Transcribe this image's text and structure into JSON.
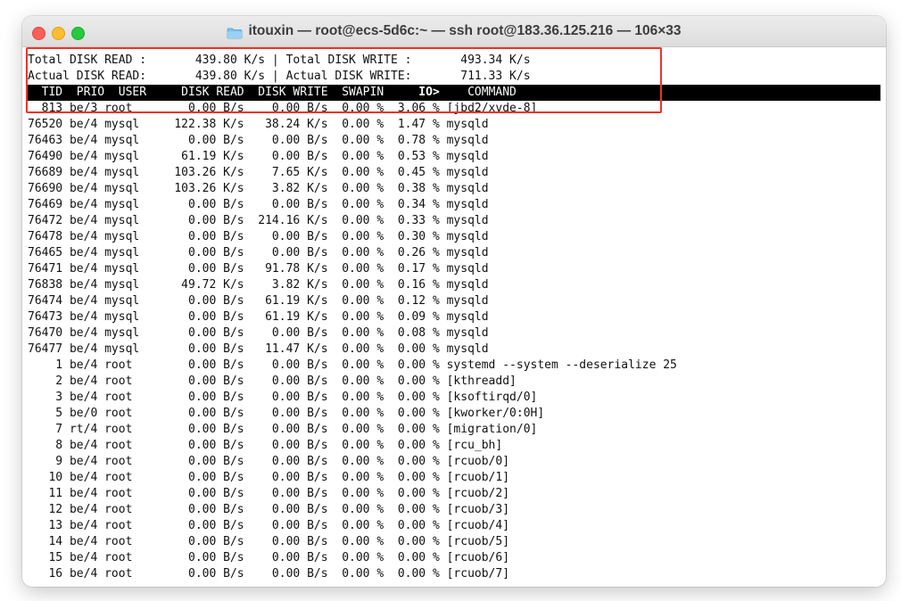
{
  "window": {
    "title": "itouxin — root@ecs-5d6c:~ — ssh root@183.36.125.216 — 106×33",
    "title_icon": "folder-icon",
    "controls": [
      "close",
      "minimize",
      "zoom"
    ]
  },
  "colors": {
    "highlight_box": "#e8362b",
    "header_bg": "#000000",
    "header_fg": "#ffffff",
    "text": "#111111"
  },
  "summary": {
    "total_read": "Total DISK READ :       439.80 K/s | Total DISK WRITE :       493.34 K/s",
    "actual_read": "Actual DISK READ:       439.80 K/s | Actual DISK WRITE:       711.33 K/s"
  },
  "header": {
    "pre": "  TID  PRIO  USER     DISK READ  DISK WRITE  SWAPIN     ",
    "sort_col": "IO>",
    "post": "    COMMAND"
  },
  "rows": [
    {
      "tid": "813",
      "prio": "be/3",
      "user": "root",
      "read": "0.00 B/s",
      "write": "0.00 B/s",
      "swapin": "0.00 %",
      "io": "3.06 %",
      "command": "[jbd2/xvde-8]"
    },
    {
      "tid": "76520",
      "prio": "be/4",
      "user": "mysql",
      "read": "122.38 K/s",
      "write": "38.24 K/s",
      "swapin": "0.00 %",
      "io": "1.47 %",
      "command": "mysqld"
    },
    {
      "tid": "76463",
      "prio": "be/4",
      "user": "mysql",
      "read": "0.00 B/s",
      "write": "0.00 B/s",
      "swapin": "0.00 %",
      "io": "0.78 %",
      "command": "mysqld"
    },
    {
      "tid": "76490",
      "prio": "be/4",
      "user": "mysql",
      "read": "61.19 K/s",
      "write": "0.00 B/s",
      "swapin": "0.00 %",
      "io": "0.53 %",
      "command": "mysqld"
    },
    {
      "tid": "76689",
      "prio": "be/4",
      "user": "mysql",
      "read": "103.26 K/s",
      "write": "7.65 K/s",
      "swapin": "0.00 %",
      "io": "0.45 %",
      "command": "mysqld"
    },
    {
      "tid": "76690",
      "prio": "be/4",
      "user": "mysql",
      "read": "103.26 K/s",
      "write": "3.82 K/s",
      "swapin": "0.00 %",
      "io": "0.38 %",
      "command": "mysqld"
    },
    {
      "tid": "76469",
      "prio": "be/4",
      "user": "mysql",
      "read": "0.00 B/s",
      "write": "0.00 B/s",
      "swapin": "0.00 %",
      "io": "0.34 %",
      "command": "mysqld"
    },
    {
      "tid": "76472",
      "prio": "be/4",
      "user": "mysql",
      "read": "0.00 B/s",
      "write": "214.16 K/s",
      "swapin": "0.00 %",
      "io": "0.33 %",
      "command": "mysqld"
    },
    {
      "tid": "76478",
      "prio": "be/4",
      "user": "mysql",
      "read": "0.00 B/s",
      "write": "0.00 B/s",
      "swapin": "0.00 %",
      "io": "0.30 %",
      "command": "mysqld"
    },
    {
      "tid": "76465",
      "prio": "be/4",
      "user": "mysql",
      "read": "0.00 B/s",
      "write": "0.00 B/s",
      "swapin": "0.00 %",
      "io": "0.26 %",
      "command": "mysqld"
    },
    {
      "tid": "76471",
      "prio": "be/4",
      "user": "mysql",
      "read": "0.00 B/s",
      "write": "91.78 K/s",
      "swapin": "0.00 %",
      "io": "0.17 %",
      "command": "mysqld"
    },
    {
      "tid": "76838",
      "prio": "be/4",
      "user": "mysql",
      "read": "49.72 K/s",
      "write": "3.82 K/s",
      "swapin": "0.00 %",
      "io": "0.16 %",
      "command": "mysqld"
    },
    {
      "tid": "76474",
      "prio": "be/4",
      "user": "mysql",
      "read": "0.00 B/s",
      "write": "61.19 K/s",
      "swapin": "0.00 %",
      "io": "0.12 %",
      "command": "mysqld"
    },
    {
      "tid": "76473",
      "prio": "be/4",
      "user": "mysql",
      "read": "0.00 B/s",
      "write": "61.19 K/s",
      "swapin": "0.00 %",
      "io": "0.09 %",
      "command": "mysqld"
    },
    {
      "tid": "76470",
      "prio": "be/4",
      "user": "mysql",
      "read": "0.00 B/s",
      "write": "0.00 B/s",
      "swapin": "0.00 %",
      "io": "0.08 %",
      "command": "mysqld"
    },
    {
      "tid": "76477",
      "prio": "be/4",
      "user": "mysql",
      "read": "0.00 B/s",
      "write": "11.47 K/s",
      "swapin": "0.00 %",
      "io": "0.00 %",
      "command": "mysqld"
    },
    {
      "tid": "1",
      "prio": "be/4",
      "user": "root",
      "read": "0.00 B/s",
      "write": "0.00 B/s",
      "swapin": "0.00 %",
      "io": "0.00 %",
      "command": "systemd --system --deserialize 25"
    },
    {
      "tid": "2",
      "prio": "be/4",
      "user": "root",
      "read": "0.00 B/s",
      "write": "0.00 B/s",
      "swapin": "0.00 %",
      "io": "0.00 %",
      "command": "[kthreadd]"
    },
    {
      "tid": "3",
      "prio": "be/4",
      "user": "root",
      "read": "0.00 B/s",
      "write": "0.00 B/s",
      "swapin": "0.00 %",
      "io": "0.00 %",
      "command": "[ksoftirqd/0]"
    },
    {
      "tid": "5",
      "prio": "be/0",
      "user": "root",
      "read": "0.00 B/s",
      "write": "0.00 B/s",
      "swapin": "0.00 %",
      "io": "0.00 %",
      "command": "[kworker/0:0H]"
    },
    {
      "tid": "7",
      "prio": "rt/4",
      "user": "root",
      "read": "0.00 B/s",
      "write": "0.00 B/s",
      "swapin": "0.00 %",
      "io": "0.00 %",
      "command": "[migration/0]"
    },
    {
      "tid": "8",
      "prio": "be/4",
      "user": "root",
      "read": "0.00 B/s",
      "write": "0.00 B/s",
      "swapin": "0.00 %",
      "io": "0.00 %",
      "command": "[rcu_bh]"
    },
    {
      "tid": "9",
      "prio": "be/4",
      "user": "root",
      "read": "0.00 B/s",
      "write": "0.00 B/s",
      "swapin": "0.00 %",
      "io": "0.00 %",
      "command": "[rcuob/0]"
    },
    {
      "tid": "10",
      "prio": "be/4",
      "user": "root",
      "read": "0.00 B/s",
      "write": "0.00 B/s",
      "swapin": "0.00 %",
      "io": "0.00 %",
      "command": "[rcuob/1]"
    },
    {
      "tid": "11",
      "prio": "be/4",
      "user": "root",
      "read": "0.00 B/s",
      "write": "0.00 B/s",
      "swapin": "0.00 %",
      "io": "0.00 %",
      "command": "[rcuob/2]"
    },
    {
      "tid": "12",
      "prio": "be/4",
      "user": "root",
      "read": "0.00 B/s",
      "write": "0.00 B/s",
      "swapin": "0.00 %",
      "io": "0.00 %",
      "command": "[rcuob/3]"
    },
    {
      "tid": "13",
      "prio": "be/4",
      "user": "root",
      "read": "0.00 B/s",
      "write": "0.00 B/s",
      "swapin": "0.00 %",
      "io": "0.00 %",
      "command": "[rcuob/4]"
    },
    {
      "tid": "14",
      "prio": "be/4",
      "user": "root",
      "read": "0.00 B/s",
      "write": "0.00 B/s",
      "swapin": "0.00 %",
      "io": "0.00 %",
      "command": "[rcuob/5]"
    },
    {
      "tid": "15",
      "prio": "be/4",
      "user": "root",
      "read": "0.00 B/s",
      "write": "0.00 B/s",
      "swapin": "0.00 %",
      "io": "0.00 %",
      "command": "[rcuob/6]"
    },
    {
      "tid": "16",
      "prio": "be/4",
      "user": "root",
      "read": "0.00 B/s",
      "write": "0.00 B/s",
      "swapin": "0.00 %",
      "io": "0.00 %",
      "command": "[rcuob/7]"
    }
  ]
}
